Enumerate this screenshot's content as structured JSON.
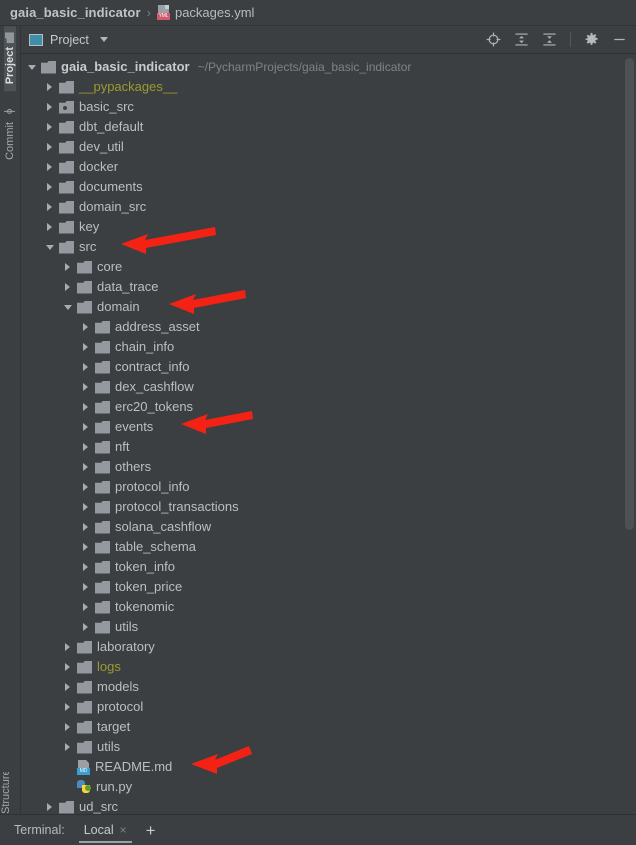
{
  "breadcrumb": {
    "project": "gaia_basic_indicator",
    "separator": "›",
    "file": "packages.yml",
    "file_icon": "yml-file-icon",
    "file_badge": "YML"
  },
  "rail": {
    "items": [
      {
        "label": "Project",
        "icon": "project-folder-icon",
        "active": true
      },
      {
        "label": "Commit",
        "icon": "commit-icon",
        "active": false
      }
    ],
    "bottom": {
      "label": "Structure",
      "icon": "structure-icon"
    }
  },
  "tool_window": {
    "title": "Project",
    "title_icon": "project-view-icon",
    "dropdown_icon": "chevron-down-icon",
    "actions": [
      {
        "name": "locate-file-icon",
        "tooltip": "Select Opened File"
      },
      {
        "name": "expand-all-icon",
        "tooltip": "Expand All"
      },
      {
        "name": "collapse-all-icon",
        "tooltip": "Collapse All"
      },
      {
        "name": "settings-gear-icon",
        "tooltip": "Options"
      },
      {
        "name": "minimize-icon",
        "tooltip": "Hide"
      }
    ]
  },
  "tree": {
    "root_path_hint": "~/PycharmProjects/gaia_basic_indicator",
    "rows": [
      {
        "label": "gaia_basic_indicator",
        "type": "folder",
        "depth": 0,
        "state": "open",
        "style": "bold",
        "hint": "~/PycharmProjects/gaia_basic_indicator"
      },
      {
        "label": "__pypackages__",
        "type": "folder",
        "depth": 1,
        "state": "closed",
        "style": "excluded"
      },
      {
        "label": "basic_src",
        "type": "folder-source",
        "depth": 1,
        "state": "closed"
      },
      {
        "label": "dbt_default",
        "type": "folder",
        "depth": 1,
        "state": "closed"
      },
      {
        "label": "dev_util",
        "type": "folder",
        "depth": 1,
        "state": "closed"
      },
      {
        "label": "docker",
        "type": "folder",
        "depth": 1,
        "state": "closed"
      },
      {
        "label": "documents",
        "type": "folder",
        "depth": 1,
        "state": "closed"
      },
      {
        "label": "domain_src",
        "type": "folder",
        "depth": 1,
        "state": "closed"
      },
      {
        "label": "key",
        "type": "folder",
        "depth": 1,
        "state": "closed"
      },
      {
        "label": "src",
        "type": "folder",
        "depth": 1,
        "state": "open"
      },
      {
        "label": "core",
        "type": "folder",
        "depth": 2,
        "state": "closed"
      },
      {
        "label": "data_trace",
        "type": "folder",
        "depth": 2,
        "state": "closed"
      },
      {
        "label": "domain",
        "type": "folder",
        "depth": 2,
        "state": "open"
      },
      {
        "label": "address_asset",
        "type": "folder",
        "depth": 3,
        "state": "closed"
      },
      {
        "label": "chain_info",
        "type": "folder",
        "depth": 3,
        "state": "closed"
      },
      {
        "label": "contract_info",
        "type": "folder",
        "depth": 3,
        "state": "closed"
      },
      {
        "label": "dex_cashflow",
        "type": "folder",
        "depth": 3,
        "state": "closed"
      },
      {
        "label": "erc20_tokens",
        "type": "folder",
        "depth": 3,
        "state": "closed"
      },
      {
        "label": "events",
        "type": "folder",
        "depth": 3,
        "state": "closed"
      },
      {
        "label": "nft",
        "type": "folder",
        "depth": 3,
        "state": "closed"
      },
      {
        "label": "others",
        "type": "folder",
        "depth": 3,
        "state": "closed"
      },
      {
        "label": "protocol_info",
        "type": "folder",
        "depth": 3,
        "state": "closed"
      },
      {
        "label": "protocol_transactions",
        "type": "folder",
        "depth": 3,
        "state": "closed"
      },
      {
        "label": "solana_cashflow",
        "type": "folder",
        "depth": 3,
        "state": "closed"
      },
      {
        "label": "table_schema",
        "type": "folder",
        "depth": 3,
        "state": "closed"
      },
      {
        "label": "token_info",
        "type": "folder",
        "depth": 3,
        "state": "closed"
      },
      {
        "label": "token_price",
        "type": "folder",
        "depth": 3,
        "state": "closed"
      },
      {
        "label": "tokenomic",
        "type": "folder",
        "depth": 3,
        "state": "closed"
      },
      {
        "label": "utils",
        "type": "folder",
        "depth": 3,
        "state": "closed"
      },
      {
        "label": "laboratory",
        "type": "folder",
        "depth": 2,
        "state": "closed"
      },
      {
        "label": "logs",
        "type": "folder",
        "depth": 2,
        "state": "closed",
        "style": "excluded"
      },
      {
        "label": "models",
        "type": "folder",
        "depth": 2,
        "state": "closed"
      },
      {
        "label": "protocol",
        "type": "folder",
        "depth": 2,
        "state": "closed"
      },
      {
        "label": "target",
        "type": "folder",
        "depth": 2,
        "state": "closed"
      },
      {
        "label": "utils",
        "type": "folder",
        "depth": 2,
        "state": "closed"
      },
      {
        "label": "README.md",
        "type": "file-md",
        "depth": 2,
        "state": "leaf"
      },
      {
        "label": "run.py",
        "type": "file-py",
        "depth": 2,
        "state": "leaf"
      },
      {
        "label": "ud_src",
        "type": "folder",
        "depth": 1,
        "state": "closed"
      }
    ]
  },
  "annotations": {
    "color": "#f42214",
    "arrows": [
      {
        "name": "arrow-pointing-src",
        "target": "src"
      },
      {
        "name": "arrow-pointing-domain",
        "target": "domain"
      },
      {
        "name": "arrow-pointing-events",
        "target": "events"
      },
      {
        "name": "arrow-pointing-readme",
        "target": "README.md"
      }
    ]
  },
  "terminal": {
    "label": "Terminal:",
    "tabs": [
      {
        "label": "Local",
        "active": true,
        "close_icon": "×"
      }
    ],
    "add_label": "+"
  },
  "colors": {
    "background": "#3c3f41",
    "panel": "#3c3f41",
    "text": "#bbbfc3",
    "excluded": "#9c9a30",
    "accent_blue": "#3f8ea8",
    "annotation_red": "#f42214"
  }
}
